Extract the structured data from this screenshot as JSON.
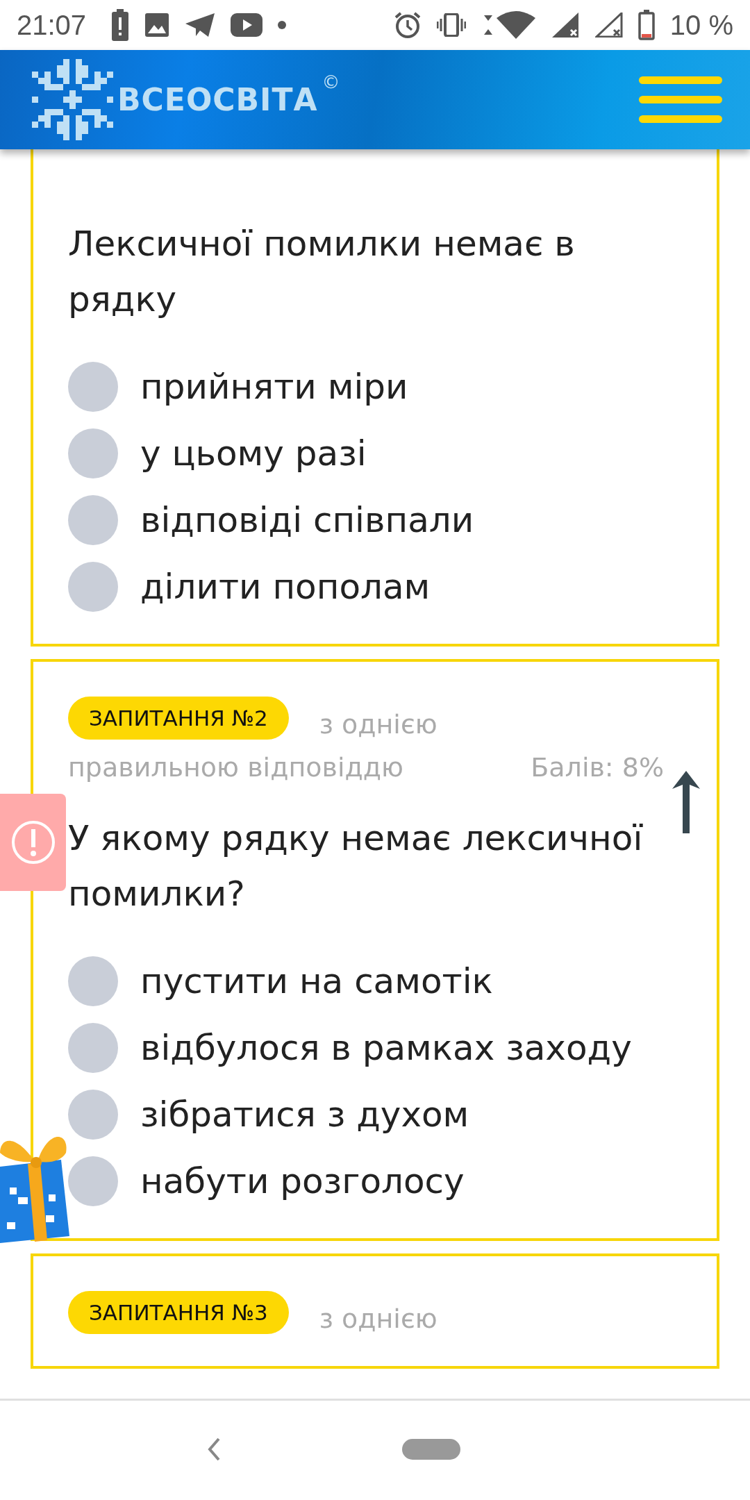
{
  "status_bar": {
    "time": "21:07",
    "battery": "10 %"
  },
  "header": {
    "logo_text": "ВСЕОСВІТА",
    "copyright": "©"
  },
  "questions": [
    {
      "text": "Лексичної помилки немає в рядку",
      "options": [
        {
          "label": "прийняти міри",
          "selected": false
        },
        {
          "label": "у цьому разі",
          "selected": false
        },
        {
          "label": "відповіді співпали",
          "selected": false
        },
        {
          "label": "ділити пополам",
          "selected": false
        }
      ]
    },
    {
      "badge": "ЗАПИТАННЯ №2",
      "type_start": "з однією",
      "type_end": "правильною відповіддю",
      "score": "Балів: 8%",
      "text": "У якому рядку немає лексичної помилки?",
      "options": [
        {
          "label": "пустити на самотік",
          "selected": false
        },
        {
          "label": "відбулося в рамках заходу",
          "selected": false
        },
        {
          "label": "зібратися з духом",
          "selected": false
        },
        {
          "label": "набути розголосу",
          "selected": false
        }
      ]
    },
    {
      "badge": "ЗАПИТАННЯ №3",
      "type_start": "з однією"
    }
  ]
}
